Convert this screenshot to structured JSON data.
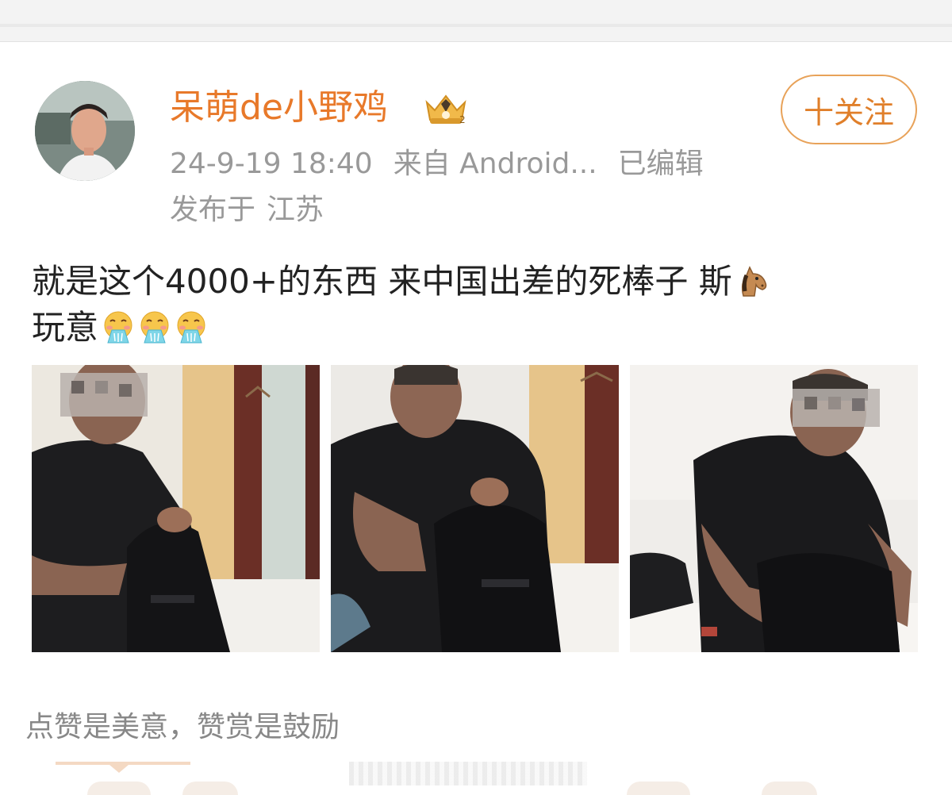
{
  "post": {
    "author": {
      "name": "呆萌de小野鸡",
      "badge_icon": "crown-badge-icon",
      "avatar_icon": "avatar-photo"
    },
    "meta": {
      "time": "24-9-19 18:40",
      "source": "来自 Android...",
      "edited": "已编辑",
      "location_prefix": "发布于",
      "location": "江苏"
    },
    "follow_label": "十关注",
    "content": {
      "line1": "就是这个4000+的东西 来中国出差的死棒子 斯",
      "line1_emoji": "horse-face-icon",
      "line2": "玩意",
      "line2_emojis": [
        "vomiting-face-icon",
        "vomiting-face-icon",
        "vomiting-face-icon"
      ]
    },
    "photos": [
      {
        "name": "photo-1"
      },
      {
        "name": "photo-2"
      },
      {
        "name": "photo-3"
      }
    ],
    "footer_note": "点赞是美意，赞赏是鼓励"
  },
  "colors": {
    "accent": "#e8792a",
    "follow_border": "#e8a259",
    "meta_text": "#999999",
    "body_text": "#222222"
  }
}
